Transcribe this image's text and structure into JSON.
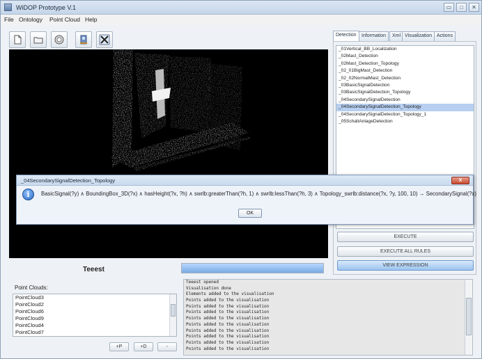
{
  "window": {
    "title": "WiDOP Prototype V.1"
  },
  "menu": [
    "File",
    "Ontology",
    "Point Cloud",
    "Help"
  ],
  "toolbar": {
    "icons": [
      "new-file-icon",
      "open-folder-icon",
      "owl-icon",
      "save-ontology-icon",
      "close-x-icon"
    ]
  },
  "main": {
    "label": "Teeest",
    "progress": 1.0
  },
  "point_clouds": {
    "label": "Point Clouds:",
    "items": [
      "PointCloud3",
      "PointCloud2",
      "PointCloud6",
      "PointCloud9",
      "PointCloud4",
      "PointCloud7"
    ],
    "buttons": {
      "add_p": "+P",
      "add_d": "+D",
      "remove": "-"
    }
  },
  "log": {
    "lines": [
      "Teeest opened",
      "Visualisation done",
      "Elements added to the visualisation",
      "Points added to the visualisation",
      "Points added to the visualisation",
      "Points added to the visualisation",
      "Points added to the visualisation",
      "Points added to the visualisation",
      "Points added to the visualisation",
      "Points added to the visualisation",
      "Points added to the visualisation",
      "Points added to the visualisation"
    ]
  },
  "tabs": [
    "Detection",
    "Information",
    "Xml",
    "Visualization",
    "Actions"
  ],
  "active_tab": "Detection",
  "detection": {
    "rules": [
      "_01Vertical_BB_Localization",
      "_02Mast_Detection",
      "_02Mast_Detection_Topology",
      "_02_01BigMast_Detection",
      "_02_02NormalMast_Detection",
      "_03BasicSignalDetection",
      "_03BasicSignalDetection_Topology",
      "_04SecondarySignalDetection",
      "_04SecondarySignalDetection_Topology",
      "_04SecondarySignalDetection_Topology_1",
      "_05SchaltAnlageDetection"
    ],
    "selected": "_04SecondarySignalDetection_Topology",
    "buttons": {
      "execute": "EXECUTE",
      "execute_all": "EXECUTE ALL RULES",
      "view_expression": "VIEW EXPRESSION"
    }
  },
  "dialog": {
    "title": "_04SecondarySignalDetection_Topology",
    "message": "BasicSignal(?y) ∧ BoundingBox_3D(?x) ∧ hasHeight(?x, ?h) ∧ swrlb:greaterThan(?h, 1) ∧ swrlb:lessThan(?h, 3) ∧ Topology_swrlb:distance(?x, ?y, 100, 10) → SecondarySignal(?x)",
    "ok": "OK",
    "close": "X"
  },
  "window_buttons": {
    "minimize": "▭",
    "maximize": "□",
    "close": "✕"
  },
  "colors": {
    "selection": "#b7cff0",
    "highlight_button": "#9bc3ef",
    "viewer_bg": "#000000"
  }
}
